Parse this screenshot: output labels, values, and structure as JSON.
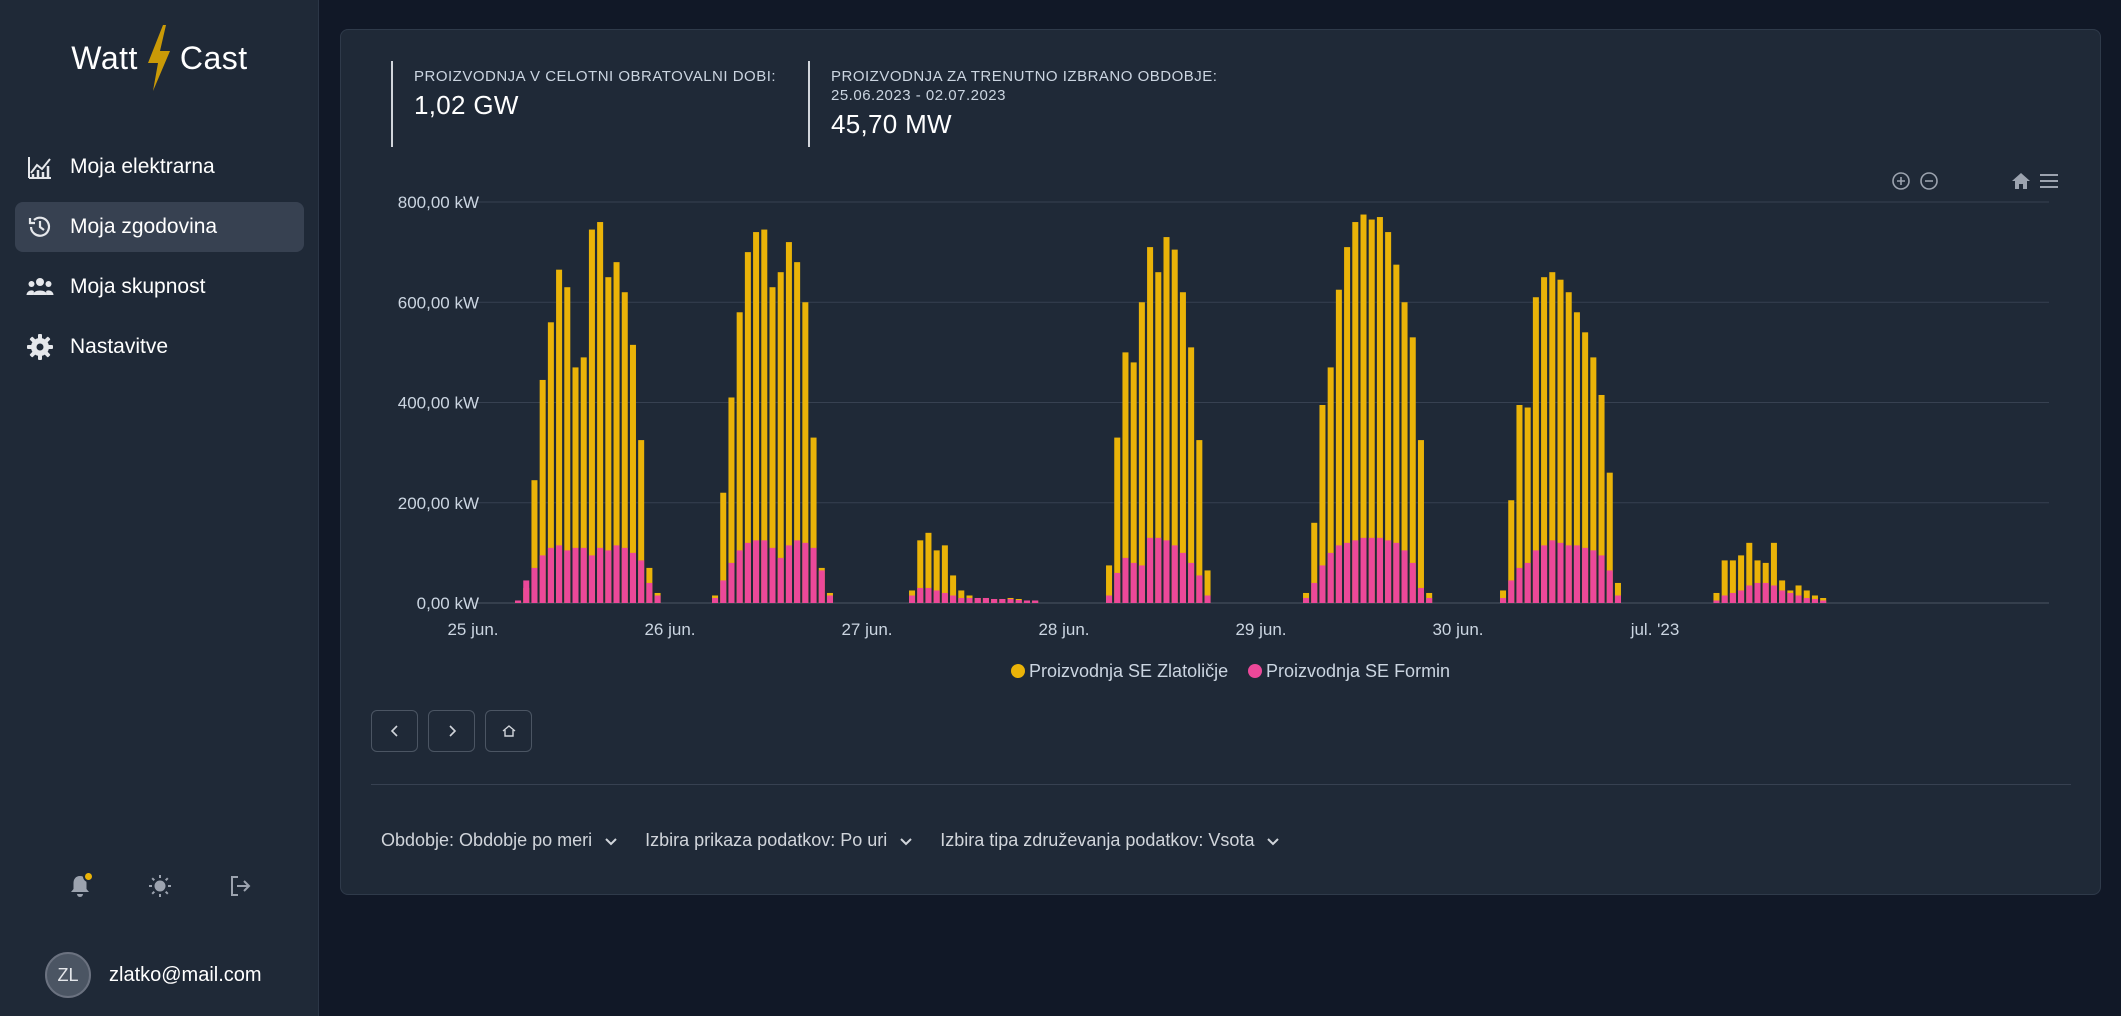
{
  "app": {
    "logo_left": "Watt",
    "logo_right": "Cast",
    "brand_color": "#eab308"
  },
  "sidebar": {
    "items": [
      {
        "label": "Moja elektrarna",
        "icon": "chart-line-icon",
        "active": false
      },
      {
        "label": "Moja zgodovina",
        "icon": "history-icon",
        "active": true
      },
      {
        "label": "Moja skupnost",
        "icon": "group-icon",
        "active": false
      },
      {
        "label": "Nastavitve",
        "icon": "gear-icon",
        "active": false
      }
    ],
    "actions": [
      "bell-icon",
      "sun-icon",
      "logout-icon"
    ],
    "user": {
      "initials": "ZL",
      "email": "zlatko@mail.com"
    }
  },
  "stats": {
    "total_label": "PROIZVODNJA V CELOTNI OBRATOVALNI DOBI:",
    "total_value": "1,02 GW",
    "period_label": "PROIZVODNJA ZA TRENUTNO IZBRANO OBDOBJE:",
    "period_range": "25.06.2023 - 02.07.2023",
    "period_value": "45,70 MW"
  },
  "chart_data": {
    "type": "bar",
    "title": "",
    "xlabel": "",
    "ylabel": "",
    "ylim": [
      0,
      800
    ],
    "y_ticks": [
      {
        "value": 0,
        "label": "0,00 kW"
      },
      {
        "value": 200,
        "label": "200,00 kW"
      },
      {
        "value": 400,
        "label": "400,00 kW"
      },
      {
        "value": 600,
        "label": "600,00 kW"
      },
      {
        "value": 800,
        "label": "800,00 kW"
      }
    ],
    "x_range_hours": [
      0,
      192
    ],
    "x_ticks": [
      {
        "hour": 0,
        "label": "25 jun."
      },
      {
        "hour": 24,
        "label": "26 jun."
      },
      {
        "hour": 48,
        "label": "27 jun."
      },
      {
        "hour": 72,
        "label": "28 jun."
      },
      {
        "hour": 96,
        "label": "29 jun."
      },
      {
        "hour": 120,
        "label": "30 jun."
      },
      {
        "hour": 144,
        "label": "jul. '23"
      }
    ],
    "grid": true,
    "legend": "bottom-center",
    "series": [
      {
        "name": "Proizvodnja SE Zlatoličje",
        "color": "#eab308",
        "days": [
          {
            "start_hour": 5,
            "values": [
              5,
              30,
              245,
              445,
              560,
              665,
              630,
              470,
              490,
              745,
              760,
              650,
              680,
              620,
              515,
              325,
              70,
              20
            ]
          },
          {
            "start_hour": 29,
            "values": [
              15,
              220,
              410,
              580,
              700,
              740,
              745,
              630,
              660,
              720,
              680,
              600,
              330,
              70,
              20
            ]
          },
          {
            "start_hour": 53,
            "values": [
              25,
              125,
              140,
              105,
              115,
              55,
              25,
              15,
              10,
              10,
              8,
              8,
              10,
              8,
              5,
              5
            ]
          },
          {
            "start_hour": 77,
            "values": [
              75,
              330,
              500,
              480,
              600,
              710,
              660,
              730,
              705,
              620,
              510,
              325,
              65
            ]
          },
          {
            "start_hour": 101,
            "values": [
              20,
              160,
              395,
              470,
              625,
              710,
              760,
              775,
              765,
              770,
              740,
              675,
              600,
              530,
              325,
              20
            ]
          },
          {
            "start_hour": 125,
            "values": [
              25,
              205,
              395,
              390,
              610,
              650,
              660,
              645,
              620,
              580,
              540,
              490,
              415,
              260,
              40
            ]
          },
          {
            "start_hour": 151,
            "values": [
              20,
              85,
              85,
              95,
              120,
              85,
              80,
              120,
              45,
              25,
              35,
              25,
              15,
              10
            ]
          }
        ]
      },
      {
        "name": "Proizvodnja SE Formin",
        "color": "#ec4899",
        "days": [
          {
            "start_hour": 5,
            "values": [
              5,
              45,
              70,
              95,
              110,
              115,
              105,
              110,
              110,
              95,
              110,
              105,
              115,
              110,
              100,
              85,
              40,
              15
            ]
          },
          {
            "start_hour": 29,
            "values": [
              10,
              45,
              80,
              105,
              120,
              125,
              125,
              110,
              90,
              115,
              125,
              120,
              110,
              65,
              15
            ]
          },
          {
            "start_hour": 53,
            "values": [
              15,
              30,
              30,
              25,
              20,
              15,
              10,
              10,
              10,
              10,
              8,
              8,
              8,
              6,
              5,
              5
            ]
          },
          {
            "start_hour": 77,
            "values": [
              15,
              60,
              90,
              80,
              75,
              130,
              130,
              125,
              115,
              100,
              80,
              55,
              15
            ]
          },
          {
            "start_hour": 101,
            "values": [
              10,
              40,
              75,
              100,
              115,
              120,
              125,
              130,
              130,
              130,
              125,
              120,
              105,
              80,
              30,
              10
            ]
          },
          {
            "start_hour": 125,
            "values": [
              10,
              45,
              70,
              80,
              105,
              115,
              125,
              120,
              115,
              115,
              110,
              105,
              95,
              65,
              15
            ]
          },
          {
            "start_hour": 151,
            "values": [
              5,
              15,
              20,
              25,
              35,
              40,
              40,
              35,
              25,
              20,
              15,
              10,
              8,
              5
            ]
          }
        ]
      }
    ]
  },
  "pager": {
    "prev": "chevron-left-icon",
    "next": "chevron-right-icon",
    "home": "home-icon"
  },
  "filters": [
    {
      "label": "Obdobje: Obdobje po meri"
    },
    {
      "label": "Izbira prikaza podatkov: Po uri"
    },
    {
      "label": "Izbira tipa združevanja podatkov: Vsota"
    }
  ]
}
